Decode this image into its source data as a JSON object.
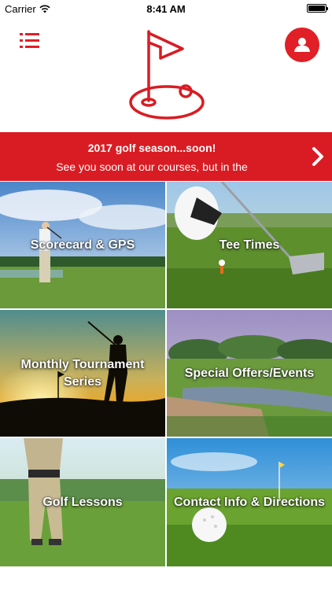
{
  "status_bar": {
    "carrier": "Carrier",
    "time": "8:41 AM"
  },
  "header": {
    "menu_icon": "list-menu-icon",
    "logo_icon": "golf-flag-hole-icon",
    "profile_icon": "user-icon"
  },
  "banner": {
    "title": "2017 golf season...soon!",
    "subtitle": "See you soon at our courses, but in the",
    "arrow_icon": "chevron-right-icon"
  },
  "tiles": [
    {
      "label": "Scorecard & GPS"
    },
    {
      "label": "Tee Times"
    },
    {
      "label": "Monthly Tournament Series"
    },
    {
      "label": "Special Offers/Events"
    },
    {
      "label": "Golf Lessons"
    },
    {
      "label": "Contact Info & Directions"
    }
  ],
  "colors": {
    "accent": "#e01f26",
    "banner": "#d91c23"
  }
}
